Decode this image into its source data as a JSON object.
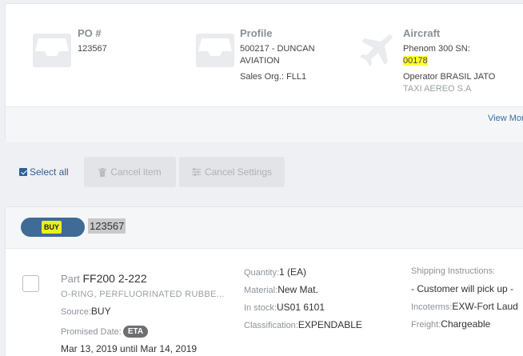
{
  "summary": {
    "po": {
      "label": "PO #",
      "value": "123567"
    },
    "profile": {
      "label": "Profile",
      "value_line1": "500217 - DUNCAN",
      "value_line2": "AVIATION",
      "sales_org": "Sales Org.: FLL1"
    },
    "aircraft": {
      "label": "Aircraft",
      "model": "Phenom 300 SN:",
      "serial": "00178",
      "operator_line1": "Operator BRASIL JATO",
      "operator_line2": "TAXI AEREO S.A"
    },
    "view_more": "View More"
  },
  "toolbar": {
    "select_all": "Select all",
    "cancel_item": "Cancel item",
    "cancel_settings": "Cancel Settings"
  },
  "order": {
    "type_badge": "BUY",
    "po_number": "123567",
    "part_prefix": "Part",
    "part_number": "FF200 2-222",
    "description": "O-RING, PERFLUORINATED RUBBE...",
    "source_label": "Source:",
    "source_value": "BUY",
    "promised_label": "Promised Date:",
    "eta_badge": "ETA",
    "promised_range": "Mar 13, 2019 until Mar 14, 2019",
    "quantity_label": "Quantity:",
    "quantity_value": "1 (EA)",
    "material_label": "Material:",
    "material_value": "New Mat.",
    "stock_label": "In stock:",
    "stock_value": "US01 6101",
    "class_label": "Classification:",
    "class_value": "EXPENDABLE",
    "ship_label": "Shipping Instructions:",
    "ship_value": "- Customer will pick up -",
    "incoterms_label": "Incoterms:",
    "incoterms_value": "EXW-Fort Laud",
    "freight_label": "Freight:",
    "freight_value": "Chargeable"
  },
  "colors": {
    "accent": "#3f6b96",
    "highlight": "#ffff33",
    "link": "#2f5f9a"
  }
}
